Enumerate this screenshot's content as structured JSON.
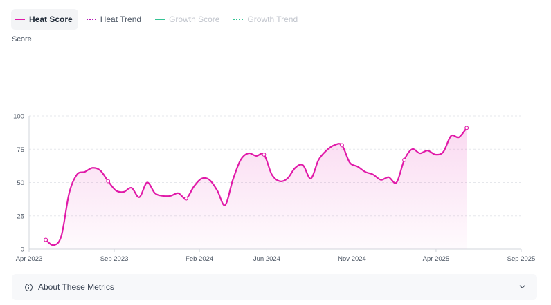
{
  "legend": [
    {
      "label": "Heat Score",
      "color": "#e01aa8",
      "style": "solid",
      "state": "active"
    },
    {
      "label": "Heat Trend",
      "color": "#b51ab5",
      "style": "dotted",
      "state": "normal"
    },
    {
      "label": "Growth Score",
      "color": "#10b981",
      "style": "solid",
      "state": "hidden"
    },
    {
      "label": "Growth Trend",
      "color": "#10b981",
      "style": "dotted",
      "state": "hidden"
    }
  ],
  "axis": {
    "ylabel": "Score"
  },
  "chart_data": {
    "type": "area",
    "ylabel": "Score",
    "ylim": [
      0,
      100
    ],
    "yticks": [
      0,
      25,
      50,
      75,
      100
    ],
    "xlim": [
      "2023-04-01",
      "2025-09-01"
    ],
    "xticks": [
      {
        "date": "2023-04-01",
        "label": "Apr 2023"
      },
      {
        "date": "2023-09-01",
        "label": "Sep 2023"
      },
      {
        "date": "2024-02-01",
        "label": "Feb 2024"
      },
      {
        "date": "2024-06-01",
        "label": "Jun 2024"
      },
      {
        "date": "2024-11-01",
        "label": "Nov 2024"
      },
      {
        "date": "2025-04-01",
        "label": "Apr 2025"
      },
      {
        "date": "2025-09-01",
        "label": "Sep 2025"
      }
    ],
    "grid": true,
    "legend_position": "top-left",
    "series": [
      {
        "name": "Heat Score",
        "color": "#e01aa8",
        "points": [
          [
            "2023-05-01",
            7
          ],
          [
            "2023-05-15",
            3
          ],
          [
            "2023-05-29",
            10
          ],
          [
            "2023-06-12",
            42
          ],
          [
            "2023-06-26",
            56
          ],
          [
            "2023-07-10",
            58
          ],
          [
            "2023-07-24",
            61
          ],
          [
            "2023-08-07",
            59
          ],
          [
            "2023-08-21",
            51
          ],
          [
            "2023-09-04",
            44
          ],
          [
            "2023-09-18",
            43
          ],
          [
            "2023-10-02",
            46
          ],
          [
            "2023-10-16",
            39
          ],
          [
            "2023-10-30",
            50
          ],
          [
            "2023-11-13",
            42
          ],
          [
            "2023-11-27",
            40
          ],
          [
            "2023-12-11",
            40
          ],
          [
            "2023-12-25",
            42
          ],
          [
            "2024-01-08",
            38
          ],
          [
            "2024-01-22",
            47
          ],
          [
            "2024-02-05",
            53
          ],
          [
            "2024-02-19",
            52
          ],
          [
            "2024-03-04",
            44
          ],
          [
            "2024-03-18",
            33
          ],
          [
            "2024-04-01",
            52
          ],
          [
            "2024-04-15",
            67
          ],
          [
            "2024-04-29",
            72
          ],
          [
            "2024-05-13",
            70
          ],
          [
            "2024-05-27",
            71
          ],
          [
            "2024-06-10",
            56
          ],
          [
            "2024-06-24",
            51
          ],
          [
            "2024-07-08",
            53
          ],
          [
            "2024-07-22",
            61
          ],
          [
            "2024-08-05",
            63
          ],
          [
            "2024-08-19",
            53
          ],
          [
            "2024-09-02",
            67
          ],
          [
            "2024-09-16",
            74
          ],
          [
            "2024-09-30",
            78
          ],
          [
            "2024-10-14",
            78
          ],
          [
            "2024-10-28",
            65
          ],
          [
            "2024-11-11",
            62
          ],
          [
            "2024-11-25",
            58
          ],
          [
            "2024-12-09",
            56
          ],
          [
            "2024-12-23",
            52
          ],
          [
            "2025-01-06",
            54
          ],
          [
            "2025-01-20",
            50
          ],
          [
            "2025-02-03",
            67
          ],
          [
            "2025-02-17",
            75
          ],
          [
            "2025-03-03",
            72
          ],
          [
            "2025-03-17",
            74
          ],
          [
            "2025-03-31",
            71
          ],
          [
            "2025-04-14",
            73
          ],
          [
            "2025-04-28",
            85
          ],
          [
            "2025-05-12",
            84
          ],
          [
            "2025-05-26",
            91
          ]
        ],
        "markers": [
          [
            "2023-05-01",
            7
          ],
          [
            "2023-08-21",
            51
          ],
          [
            "2024-01-08",
            38
          ],
          [
            "2024-05-27",
            71
          ],
          [
            "2024-10-14",
            78
          ],
          [
            "2025-02-03",
            67
          ],
          [
            "2025-05-26",
            91
          ]
        ]
      }
    ]
  },
  "about": {
    "title": "About These Metrics"
  }
}
